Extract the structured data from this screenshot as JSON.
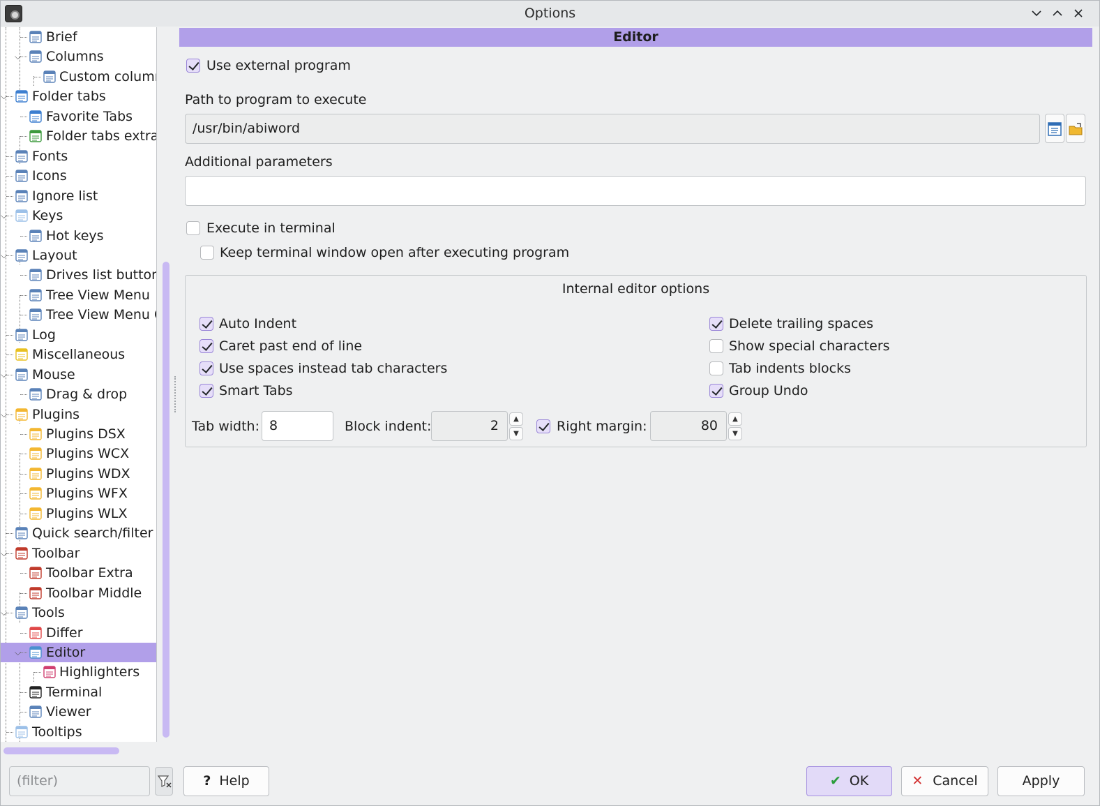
{
  "window": {
    "title": "Options"
  },
  "tree": {
    "items": [
      {
        "label": "Brief",
        "icon": "brief-view-icon",
        "level": 2
      },
      {
        "label": "Columns",
        "icon": "columns-view-icon",
        "level": 2
      },
      {
        "label": "Custom column",
        "icon": "custom-columns-icon",
        "level": 3
      },
      {
        "label": "Folder tabs",
        "icon": "folder-tabs-icon",
        "level": 1
      },
      {
        "label": "Favorite Tabs",
        "icon": "favorite-tabs-icon",
        "level": 2
      },
      {
        "label": "Folder tabs extra",
        "icon": "folder-tabs-extra-icon",
        "level": 2
      },
      {
        "label": "Fonts",
        "icon": "fonts-icon",
        "level": 1
      },
      {
        "label": "Icons",
        "icon": "icons-icon",
        "level": 1
      },
      {
        "label": "Ignore list",
        "icon": "ignore-list-icon",
        "level": 1
      },
      {
        "label": "Keys",
        "icon": "keyboard-icon",
        "level": 1
      },
      {
        "label": "Hot keys",
        "icon": "hot-keys-icon",
        "level": 2
      },
      {
        "label": "Layout",
        "icon": "layout-icon",
        "level": 1
      },
      {
        "label": "Drives list button",
        "icon": "drives-list-icon",
        "level": 2
      },
      {
        "label": "Tree View Menu",
        "icon": "tree-view-menu-icon",
        "level": 2
      },
      {
        "label": "Tree View Menu C",
        "icon": "tree-view-menu-colors-icon",
        "level": 2
      },
      {
        "label": "Log",
        "icon": "log-icon",
        "level": 1
      },
      {
        "label": "Miscellaneous",
        "icon": "miscellaneous-icon",
        "level": 1
      },
      {
        "label": "Mouse",
        "icon": "mouse-icon",
        "level": 1
      },
      {
        "label": "Drag & drop",
        "icon": "drag-drop-icon",
        "level": 2
      },
      {
        "label": "Plugins",
        "icon": "plugin-icon",
        "level": 1
      },
      {
        "label": "Plugins DSX",
        "icon": "plugin-icon",
        "level": 2
      },
      {
        "label": "Plugins WCX",
        "icon": "plugin-icon",
        "level": 2
      },
      {
        "label": "Plugins WDX",
        "icon": "plugin-icon",
        "level": 2
      },
      {
        "label": "Plugins WFX",
        "icon": "plugin-icon",
        "level": 2
      },
      {
        "label": "Plugins WLX",
        "icon": "plugin-icon",
        "level": 2
      },
      {
        "label": "Quick search/filter",
        "icon": "quick-search-icon",
        "level": 1
      },
      {
        "label": "Toolbar",
        "icon": "toolbar-icon",
        "level": 1
      },
      {
        "label": "Toolbar Extra",
        "icon": "toolbar-icon",
        "level": 2
      },
      {
        "label": "Toolbar Middle",
        "icon": "toolbar-icon",
        "level": 2
      },
      {
        "label": "Tools",
        "icon": "tools-icon",
        "level": 1
      },
      {
        "label": "Differ",
        "icon": "differ-icon",
        "level": 2
      },
      {
        "label": "Editor",
        "icon": "editor-icon",
        "level": 2,
        "selected": true
      },
      {
        "label": "Highlighters",
        "icon": "highlighters-icon",
        "level": 3
      },
      {
        "label": "Terminal",
        "icon": "terminal-icon",
        "level": 2
      },
      {
        "label": "Viewer",
        "icon": "viewer-icon",
        "level": 2
      },
      {
        "label": "Tooltips",
        "icon": "tooltips-icon",
        "level": 1
      }
    ]
  },
  "editor": {
    "header": "Editor",
    "use_external": {
      "label": "Use external program",
      "checked": true
    },
    "path_label": "Path to program to execute",
    "path_value": "/usr/bin/abiword",
    "params_label": "Additional parameters",
    "params_value": "",
    "exec_terminal": {
      "label": "Execute in terminal",
      "checked": false
    },
    "keep_open": {
      "label": "Keep terminal window open after executing program",
      "checked": false
    },
    "internal": {
      "title": "Internal editor options",
      "left_options": [
        {
          "label": "Auto Indent",
          "checked": true
        },
        {
          "label": "Caret past end of line",
          "checked": true
        },
        {
          "label": "Use spaces instead tab characters",
          "checked": true
        },
        {
          "label": "Smart Tabs",
          "checked": true
        }
      ],
      "right_options": [
        {
          "label": "Delete trailing spaces",
          "checked": true
        },
        {
          "label": "Show special characters",
          "checked": false
        },
        {
          "label": "Tab indents blocks",
          "checked": false
        },
        {
          "label": "Group Undo",
          "checked": true
        }
      ],
      "tab_width_label": "Tab width:",
      "tab_width_value": "8",
      "block_indent_label": "Block indent:",
      "block_indent_value": "2",
      "right_margin_label": "Right margin:",
      "right_margin_checked": true,
      "right_margin_value": "80"
    }
  },
  "footer": {
    "filter_placeholder": "(filter)",
    "help_label": "Help",
    "ok_label": "OK",
    "cancel_label": "Cancel",
    "apply_label": "Apply"
  },
  "colors": {
    "accent": "#b19fe9",
    "ok_check": "#2a9d3b",
    "cancel_x": "#d32f2f"
  }
}
